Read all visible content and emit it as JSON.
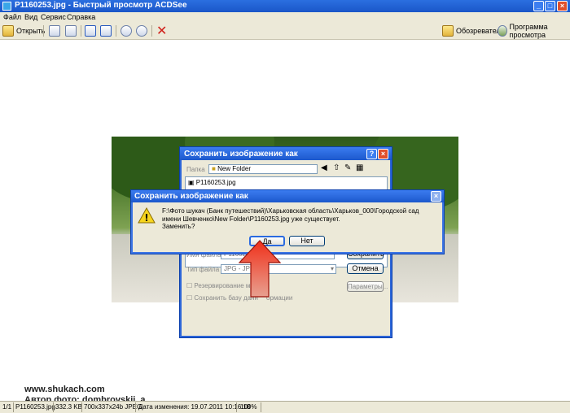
{
  "window": {
    "title": "P1160253.jpg - Быстрый просмотр ACDSee"
  },
  "menu": [
    "Файл",
    "Вид",
    "Сервис",
    "Справка"
  ],
  "toolbar": {
    "open_label": "Открыть",
    "browser_label": "Обозреватель",
    "viewer_label": "Программа просмотра"
  },
  "back_dialog": {
    "title": "Сохранить изображение как",
    "folder_label": "Папка",
    "folder_value": "New Folder",
    "file_item": "P1160253.jpg",
    "filename_label": "Имя файла",
    "filename_value": "P1160253",
    "filetype_label": "Тип файла",
    "filetype_value": "JPG - JPEG",
    "save_label": "Сохранить",
    "cancel_label": "Отмена",
    "params_label": "Параметры...",
    "check1": "Резервирование мет",
    "check2": "Сохранить базу данн",
    "check2_tail": "ормации"
  },
  "front_dialog": {
    "title": "Сохранить изображение как",
    "message": "F:\\Фото шукач (Банк путешествий)\\Харьковская область\\Харьков_000\\Городской сад имени Шевченко\\New Folder\\P1160253.jpg уже существует.",
    "question": "Заменить?",
    "yes_label": "Да",
    "no_label": "Нет"
  },
  "status": {
    "index": "1/1",
    "filename": "P1160253.jpg",
    "size": "332.3 KB",
    "dims": "700x337x24b JPEG",
    "date": "Дата изменения: 19.07.2011 10:16:18",
    "zoom": "100%"
  },
  "credits": {
    "site": "www.shukach.com",
    "author": "Автор фото: dombrovskii_a"
  },
  "colors": {
    "titlebar": "#1a56c8",
    "arrow": "#d81e10",
    "chrome": "#ece9d8"
  }
}
